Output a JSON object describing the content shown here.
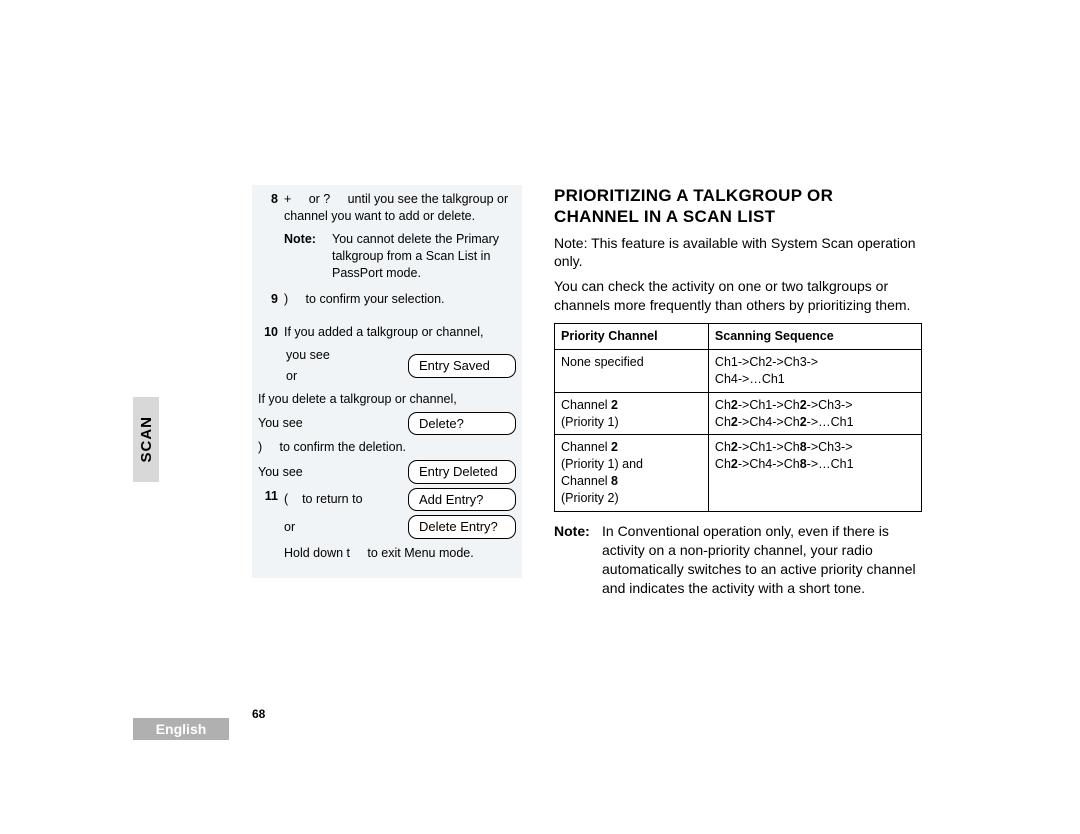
{
  "side_tab": "SCAN",
  "footer_lang": "English",
  "page_number": "68",
  "left": {
    "step8_num": "8",
    "step8_text_a": "+",
    "step8_text_b": "or ?",
    "step8_text_c": "until you see the talkgroup or channel you want to add or delete.",
    "note_label": "Note:",
    "step8_note": "You cannot delete the Primary talkgroup from a Scan List in PassPort mode.",
    "step9_num": "9",
    "step9_sym": ")",
    "step9_text": "to confirm your selection.",
    "step10_num": "10",
    "step10_text": "If you added a talkgroup or channel,",
    "step10_yousee": "you see",
    "step10_or": "or",
    "display_entry_saved": "Entry Saved",
    "step10_delete_text": "If you delete a talkgroup or channel,",
    "step10_yousee2": "You see",
    "display_delete": "Delete?",
    "step10_sym2": ")",
    "step10_confirm": "to confirm the deletion.",
    "step10_yousee3": "You see",
    "display_entry_deleted": "Entry Deleted",
    "step11_num": "11",
    "step11_sym": "(",
    "step11_text": "to return to",
    "display_add_entry": "Add Entry?",
    "step11_or": "or",
    "display_delete_entry": "Delete Entry?",
    "step11_hold_a": "Hold down t",
    "step11_hold_b": "to exit Menu mode."
  },
  "right": {
    "heading": "PRIORITIZING A TALKGROUP OR CHANNEL IN A SCAN LIST",
    "note1": "Note: This feature is available with System Scan operation only.",
    "para1": "You can check the activity on one or two talkgroups or channels more frequently than others by prioritizing them.",
    "th1": "Priority Channel",
    "th2": "Scanning Sequence",
    "row1c1": "None specified",
    "row1c2a": "Ch1->Ch2->Ch3->",
    "row1c2b": "Ch4->…Ch1",
    "row2c1": "Channel 2\n(Priority 1)",
    "row2c2a": "Ch2->Ch1->Ch2->Ch3->",
    "row2c2b": "Ch2->Ch4->Ch2->…Ch1",
    "row3c1": "Channel 2\n(Priority 1) and\nChannel 8\n(Priority 2)",
    "row3c2a": "Ch2->Ch1->Ch8->Ch3->",
    "row3c2b": "Ch2->Ch4->Ch8->…Ch1",
    "note2_label": "Note:",
    "note2_text": "In Conventional operation only, even if there is activity on a non-priority channel, your radio automatically switches to an active priority channel and indicates the activity with a short tone."
  }
}
